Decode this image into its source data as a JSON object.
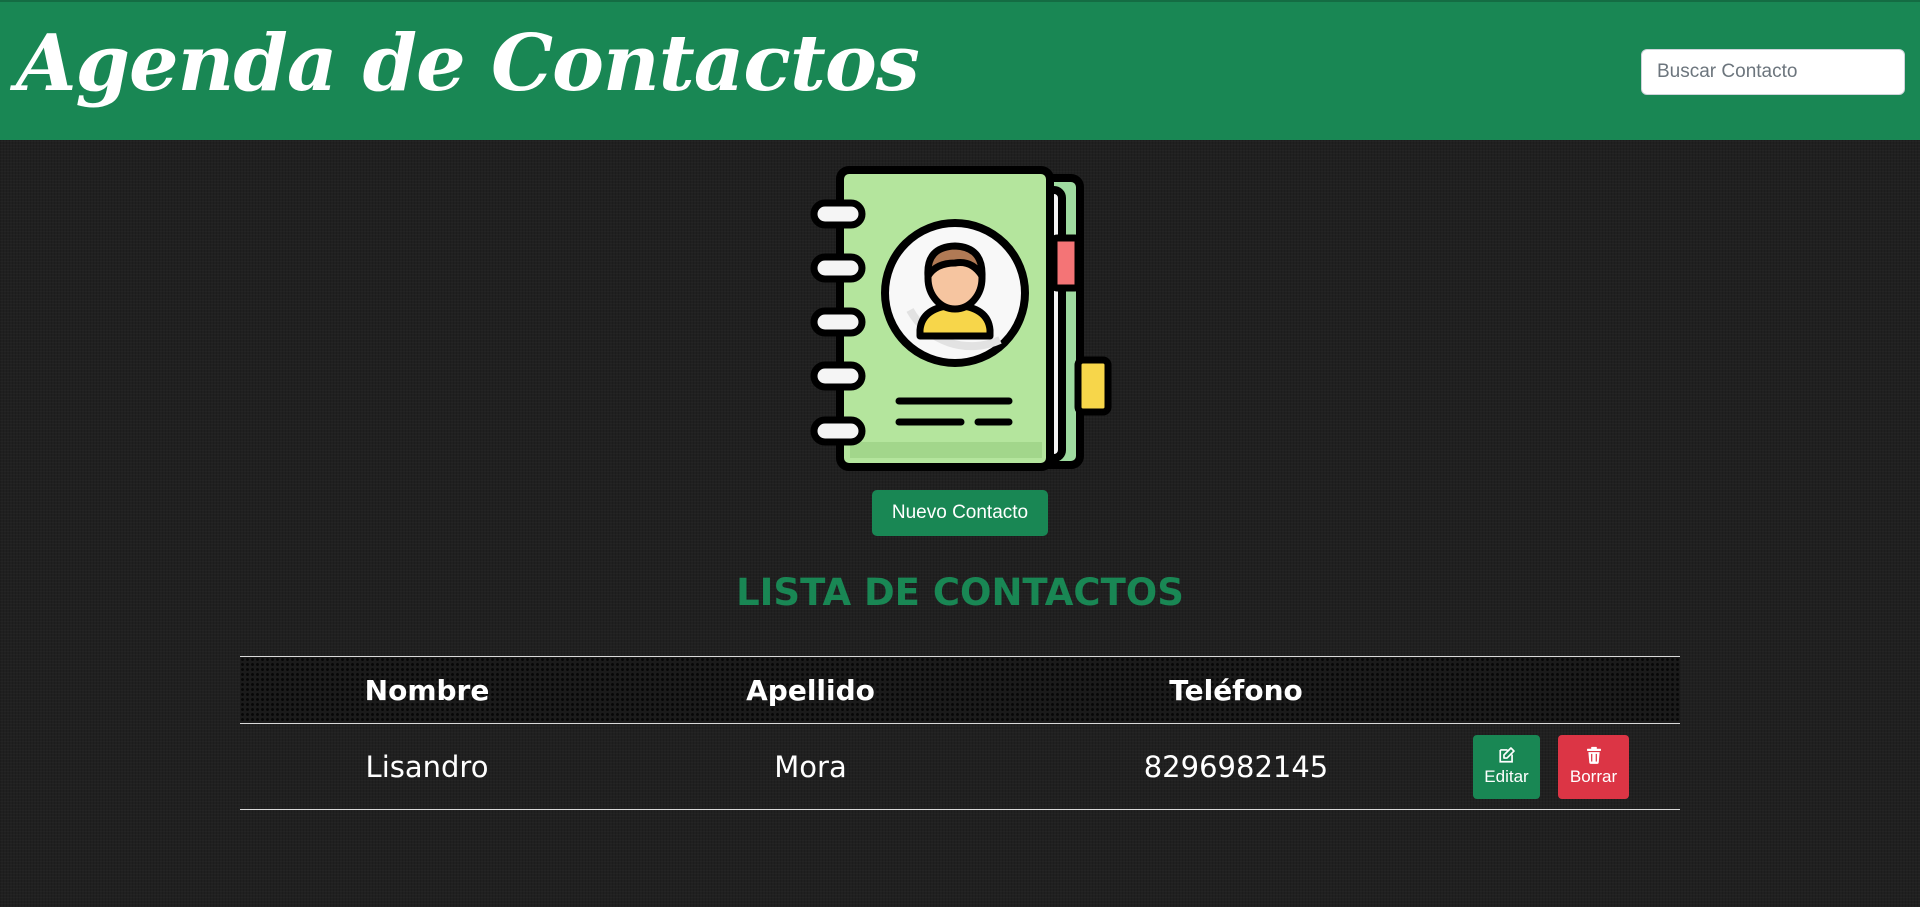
{
  "header": {
    "title": "Agenda de Contactos",
    "search_placeholder": "Buscar Contacto",
    "background_color": "#198754"
  },
  "hero": {
    "image_icon": "address-book-icon",
    "new_contact_label": "Nuevo Contacto"
  },
  "list": {
    "title": "LISTA DE CONTACTOS",
    "columns": [
      "Nombre",
      "Apellido",
      "Teléfono",
      ""
    ],
    "rows": [
      {
        "nombre": "Lisandro",
        "apellido": "Mora",
        "telefono": "8296982145",
        "edit_label": "Editar",
        "edit_icon": "edit-icon",
        "delete_label": "Borrar",
        "delete_icon": "trash-icon"
      }
    ]
  },
  "colors": {
    "primary": "#198754",
    "danger": "#dc3545",
    "background": "#202020",
    "text": "#ffffff"
  }
}
